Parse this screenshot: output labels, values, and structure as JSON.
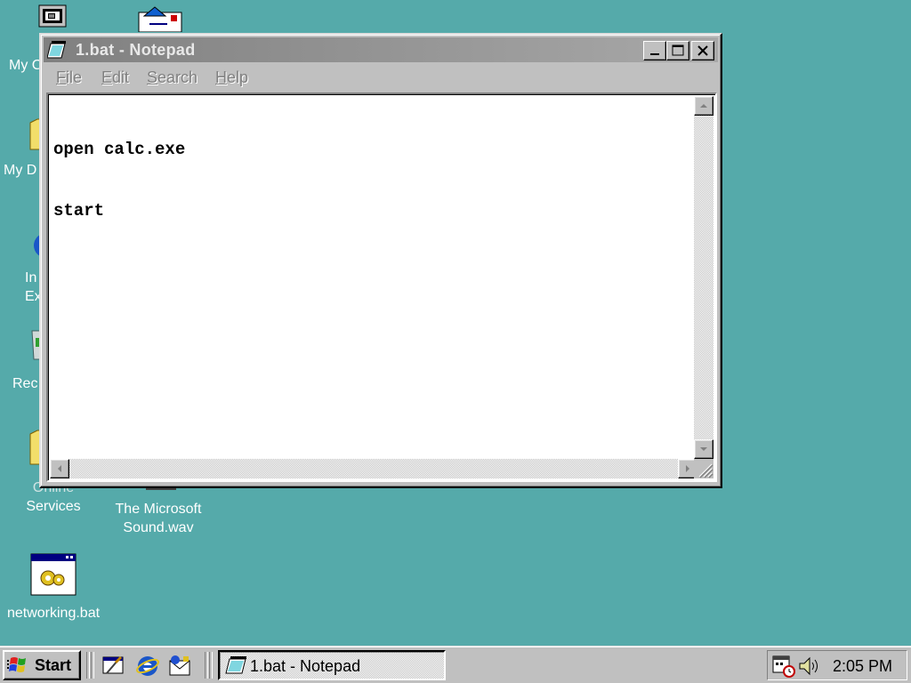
{
  "desktop": {
    "background": "#55aaaa",
    "icons": [
      {
        "label": "My C",
        "icon": "my-computer-icon"
      },
      {
        "label": "",
        "icon": "inbox-icon"
      },
      {
        "label": "My D",
        "icon": "my-documents-icon"
      },
      {
        "label": "In",
        "label2": "Ex",
        "icon": "internet-explorer-icon"
      },
      {
        "label": "Rec",
        "icon": "recycle-bin-icon"
      },
      {
        "label": "Online",
        "label2": "Services",
        "icon": "online-services-icon"
      },
      {
        "label": "The Microsoft",
        "label2": "Sound.wav",
        "icon": "sound-file-icon"
      },
      {
        "label": "networking.bat",
        "icon": "batch-file-icon"
      }
    ]
  },
  "notepad": {
    "title": "1.bat - Notepad",
    "menu": [
      "File",
      "Edit",
      "Search",
      "Help"
    ],
    "content_lines": [
      "open calc.exe",
      "start"
    ]
  },
  "taskbar": {
    "start_label": "Start",
    "quick_launch": [
      "show-desktop-icon",
      "internet-explorer-icon",
      "outlook-express-icon"
    ],
    "task_button_label": "1.bat - Notepad",
    "tray_icons": [
      "scheduler-icon",
      "volume-icon"
    ],
    "clock": "2:05 PM"
  }
}
